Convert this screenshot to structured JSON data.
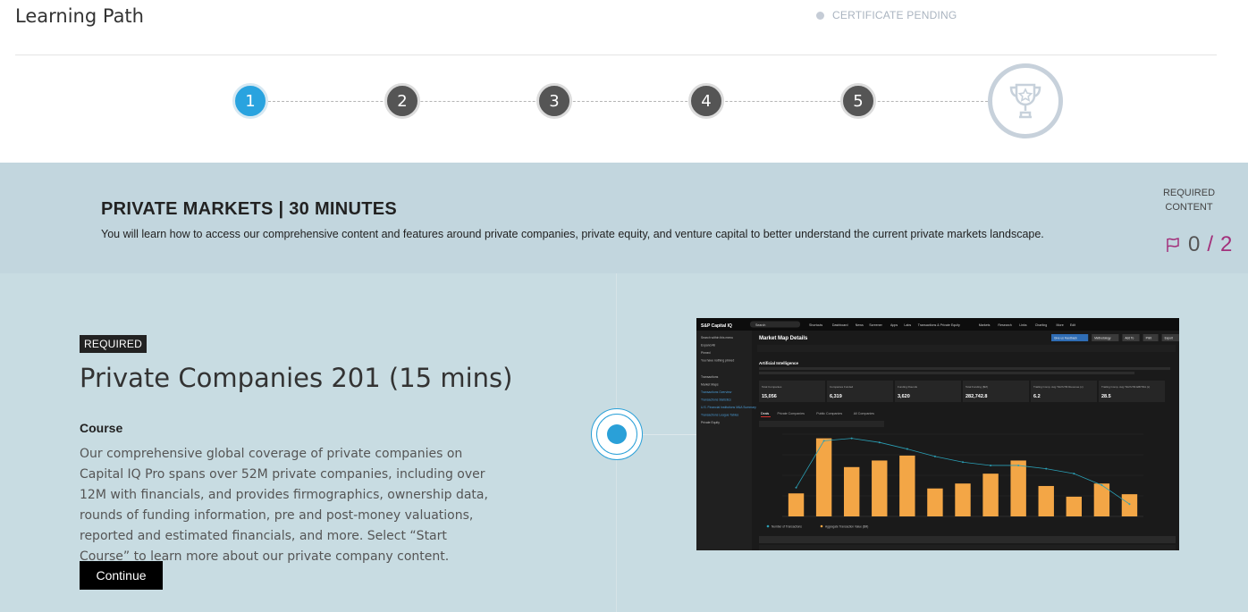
{
  "header": {
    "title": "Learning Path",
    "certificate_status": "CERTIFICATE PENDING"
  },
  "steps": [
    "1",
    "2",
    "3",
    "4",
    "5"
  ],
  "active_step": "1",
  "module": {
    "title": "PRIVATE MARKETS | 30 MINUTES",
    "description": "You will learn how to access our comprehensive content and features around private companies, private equity, and venture capital to better understand the current private markets landscape.",
    "required_label_1": "REQUIRED",
    "required_label_2": "CONTENT",
    "completed": "0",
    "total": "2"
  },
  "course": {
    "badge": "REQUIRED",
    "title": "Private Companies 201 (15 mins)",
    "type": "Course",
    "description": "Our comprehensive global coverage of private companies on Capital IQ Pro spans over 52M private companies, including over 12M with financials, and provides firmographics, ownership data, rounds of funding information, pre and post-money valuations, reported and estimated financials, and more. Select “Start Course” to learn more about our private company content.",
    "button": "Continue"
  },
  "screenshot": {
    "brand": "S&P Capital IQ",
    "nav": [
      "Search",
      "Shortcuts",
      "Dashboard",
      "News",
      "Screener",
      "Apps",
      "Labs",
      "Transactions & Private Equity",
      "Markets",
      "Research",
      "Links",
      "Charting",
      "More",
      "Edit"
    ],
    "page_title": "Market Map Details",
    "section_title": "Artificial Intelligence",
    "buttons": [
      "Give us Feedback",
      "Methodology",
      "Add To",
      "Print",
      "Export"
    ],
    "sidebar": [
      "Search within this menu",
      "Expand All",
      "Pinned",
      "You have nothing pinned",
      "Transactions",
      "Market Maps",
      "Transactions Overview",
      "Transactions Statistics",
      "U.S. Financial Institutions M&A Summary",
      "Transactions League Tables",
      "Private Equity"
    ],
    "stats": [
      {
        "label": "Total Companies",
        "value": "15,056"
      },
      {
        "label": "Companies Funded",
        "value": "6,319"
      },
      {
        "label": "Funding Rounds",
        "value": "3,620"
      },
      {
        "label": "Total Funding ($M)",
        "value": "282,742.8"
      },
      {
        "label": "Trailing Comp. Avg TEV/LTM Revenue (x)",
        "value": "6.2"
      },
      {
        "label": "Trailing Comp. Avg TEV/LTM EBITDA (x)",
        "value": "28.5"
      }
    ],
    "tabs": [
      "Deals",
      "Private Companies",
      "Public Companies",
      "All Companies"
    ],
    "legend": [
      "Number of Transactions",
      "Aggregate Transaction Value ($M)"
    ],
    "bar_values": [
      0.28,
      0.95,
      0.6,
      0.68,
      0.74,
      0.34,
      0.4,
      0.52,
      0.68,
      0.37,
      0.24,
      0.4,
      0.27
    ],
    "line_values": [
      0.35,
      0.92,
      0.95,
      0.9,
      0.82,
      0.73,
      0.66,
      0.62,
      0.62,
      0.58,
      0.52,
      0.38,
      0.15
    ],
    "bar_color": "#f3a646",
    "line_color": "#2a9fb5"
  },
  "colors": {
    "active_step": "#29a3df",
    "band": "#c2d6de",
    "main": "#c8dce2",
    "progress": "#a3307b"
  }
}
